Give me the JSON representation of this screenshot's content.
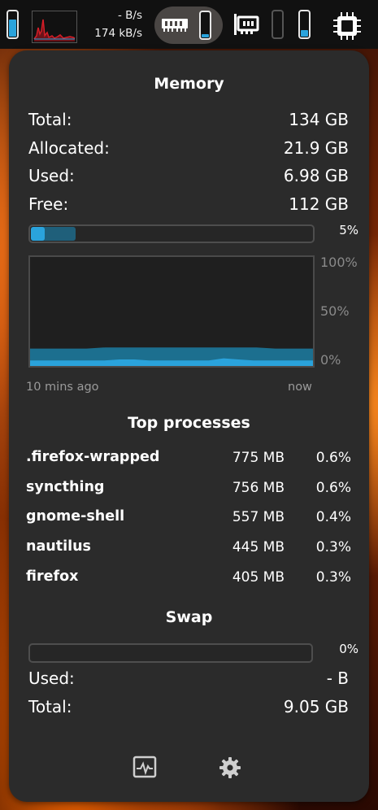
{
  "topbar": {
    "net_up": "- B/s",
    "net_down": "174 kB/s",
    "icons": [
      "cpu-bar",
      "network-graph",
      "memory-icon",
      "memory-bar",
      "network-card-icon",
      "bar",
      "bar",
      "cpu-chip-icon"
    ],
    "accent": "#2aa3dc",
    "graph_color": "#e0202a"
  },
  "memory": {
    "title": "Memory",
    "rows": [
      {
        "label": "Total:",
        "value": "134 GB"
      },
      {
        "label": "Allocated:",
        "value": "21.9 GB"
      },
      {
        "label": "Used:",
        "value": "6.98 GB"
      },
      {
        "label": "Free:",
        "value": "112 GB"
      }
    ],
    "usage_percent_label": "5%",
    "usage_fraction": 0.05,
    "allocated_fraction": 0.16,
    "chart": {
      "y_labels": [
        "100%",
        "50%",
        "0%"
      ],
      "x_left": "10 mins ago",
      "x_right": "now"
    }
  },
  "chart_data": {
    "type": "area",
    "series": [
      {
        "values": [
          16,
          16,
          16,
          16,
          17,
          17,
          17,
          17,
          17,
          17,
          17,
          17,
          17,
          16,
          16,
          16
        ]
      },
      {
        "values": [
          5,
          5,
          5,
          5,
          5,
          5,
          6,
          6,
          5,
          5,
          5,
          5,
          5,
          7,
          6,
          5,
          5,
          5,
          5,
          5
        ]
      }
    ],
    "ylim": [
      0,
      100
    ],
    "y_ticks": [
      "100%",
      "50%",
      "0%"
    ],
    "x_ticks": [
      "10 mins ago",
      "now"
    ]
  },
  "top_processes": {
    "title": "Top processes",
    "rows": [
      {
        "name": ".firefox-wrapped",
        "mem": "775 MB",
        "pct": "0.6%"
      },
      {
        "name": "syncthing",
        "mem": "756 MB",
        "pct": "0.6%"
      },
      {
        "name": "gnome-shell",
        "mem": "557 MB",
        "pct": "0.4%"
      },
      {
        "name": "nautilus",
        "mem": "445 MB",
        "pct": "0.3%"
      },
      {
        "name": "firefox",
        "mem": "405 MB",
        "pct": "0.3%"
      }
    ]
  },
  "swap": {
    "title": "Swap",
    "percent_label": "0%",
    "rows": [
      {
        "label": "Used:",
        "value": "- B"
      },
      {
        "label": "Total:",
        "value": "9.05 GB"
      }
    ]
  },
  "footer": {
    "icons": [
      "system-monitor-icon",
      "settings-gear-icon"
    ]
  }
}
